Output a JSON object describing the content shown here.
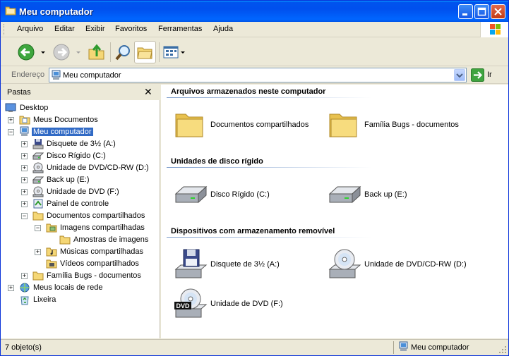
{
  "window": {
    "title": "Meu computador"
  },
  "menu": [
    "Arquivo",
    "Editar",
    "Exibir",
    "Favoritos",
    "Ferramentas",
    "Ajuda"
  ],
  "address": {
    "label": "Endereço",
    "value": "Meu computador",
    "go_label": "Ir"
  },
  "folders": {
    "title": "Pastas",
    "tree": [
      {
        "label": "Desktop",
        "icon": "desktop-icon"
      },
      {
        "label": "Meus Documentos",
        "icon": "documents-folder-icon"
      },
      {
        "label": "Meu computador",
        "icon": "computer-icon",
        "selected": true
      },
      {
        "label": "Disquete de 3½ (A:)",
        "icon": "floppy-icon"
      },
      {
        "label": "Disco Rígido (C:)",
        "icon": "hard-drive-icon"
      },
      {
        "label": "Unidade de DVD/CD-RW (D:)",
        "icon": "cd-drive-icon"
      },
      {
        "label": "Back up (E:)",
        "icon": "hard-drive-icon"
      },
      {
        "label": "Unidade de DVD (F:)",
        "icon": "dvd-drive-icon"
      },
      {
        "label": "Painel de controle",
        "icon": "control-panel-icon"
      },
      {
        "label": "Documentos compartilhados",
        "icon": "folder-icon"
      },
      {
        "label": "Imagens compartilhadas",
        "icon": "pictures-folder-icon"
      },
      {
        "label": "Amostras de imagens",
        "icon": "folder-icon"
      },
      {
        "label": "Músicas compartilhadas",
        "icon": "music-folder-icon"
      },
      {
        "label": "Vídeos compartilhados",
        "icon": "video-folder-icon"
      },
      {
        "label": "Família Bugs - documentos",
        "icon": "folder-icon"
      },
      {
        "label": "Meus locais de rede",
        "icon": "network-icon"
      },
      {
        "label": "Lixeira",
        "icon": "recycle-bin-icon"
      }
    ]
  },
  "groups": [
    {
      "title": "Arquivos armazenados neste computador",
      "items": [
        {
          "label": "Documentos compartilhados",
          "icon": "folder-icon"
        },
        {
          "label": "Família Bugs - documentos",
          "icon": "folder-icon"
        }
      ]
    },
    {
      "title": "Unidades de disco rígido",
      "items": [
        {
          "label": "Disco Rígido (C:)",
          "icon": "hard-drive-icon"
        },
        {
          "label": "Back up (E:)",
          "icon": "hard-drive-icon"
        }
      ]
    },
    {
      "title": "Dispositivos com armazenamento removível",
      "items": [
        {
          "label": "Disquete de 3½ (A:)",
          "icon": "floppy-icon"
        },
        {
          "label": "Unidade de DVD/CD-RW (D:)",
          "icon": "cd-drive-icon"
        },
        {
          "label": "Unidade de DVD (F:)",
          "icon": "dvd-drive-icon",
          "badge": "DVD"
        }
      ]
    }
  ],
  "status": {
    "left": "7 objeto(s)",
    "right": "Meu computador"
  },
  "colors": {
    "title_bar": "#0054e3",
    "selection": "#316ac5",
    "folder": "#f5d776"
  }
}
